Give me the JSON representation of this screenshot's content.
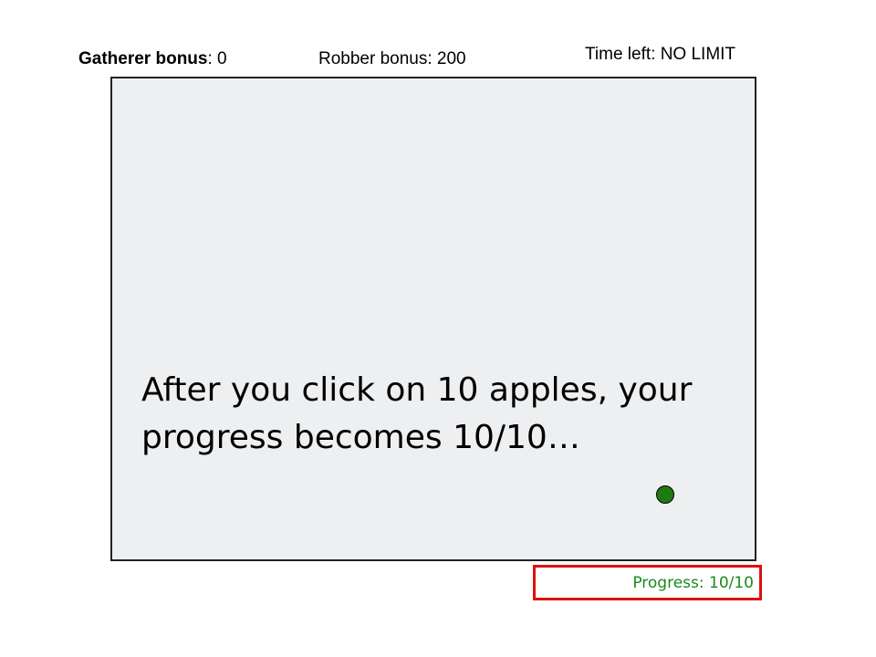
{
  "hud": {
    "gatherer_label": "Gatherer bonus",
    "gatherer_value": ": 0",
    "robber_text": "Robber bonus: 200",
    "time_left_text": "Time left: NO LIMIT"
  },
  "game": {
    "instruction_line1": "After you click on 10 apples, your",
    "instruction_line2": "progress becomes 10/10…",
    "apple_icon": "green-circle"
  },
  "progress": {
    "text": "Progress: 10/10",
    "completed": 10,
    "total": 10
  },
  "colors": {
    "game_background": "#eeeff1",
    "apple": "#1f7a12",
    "progress_text": "#1a8a1a",
    "highlight_border": "#e01010"
  }
}
